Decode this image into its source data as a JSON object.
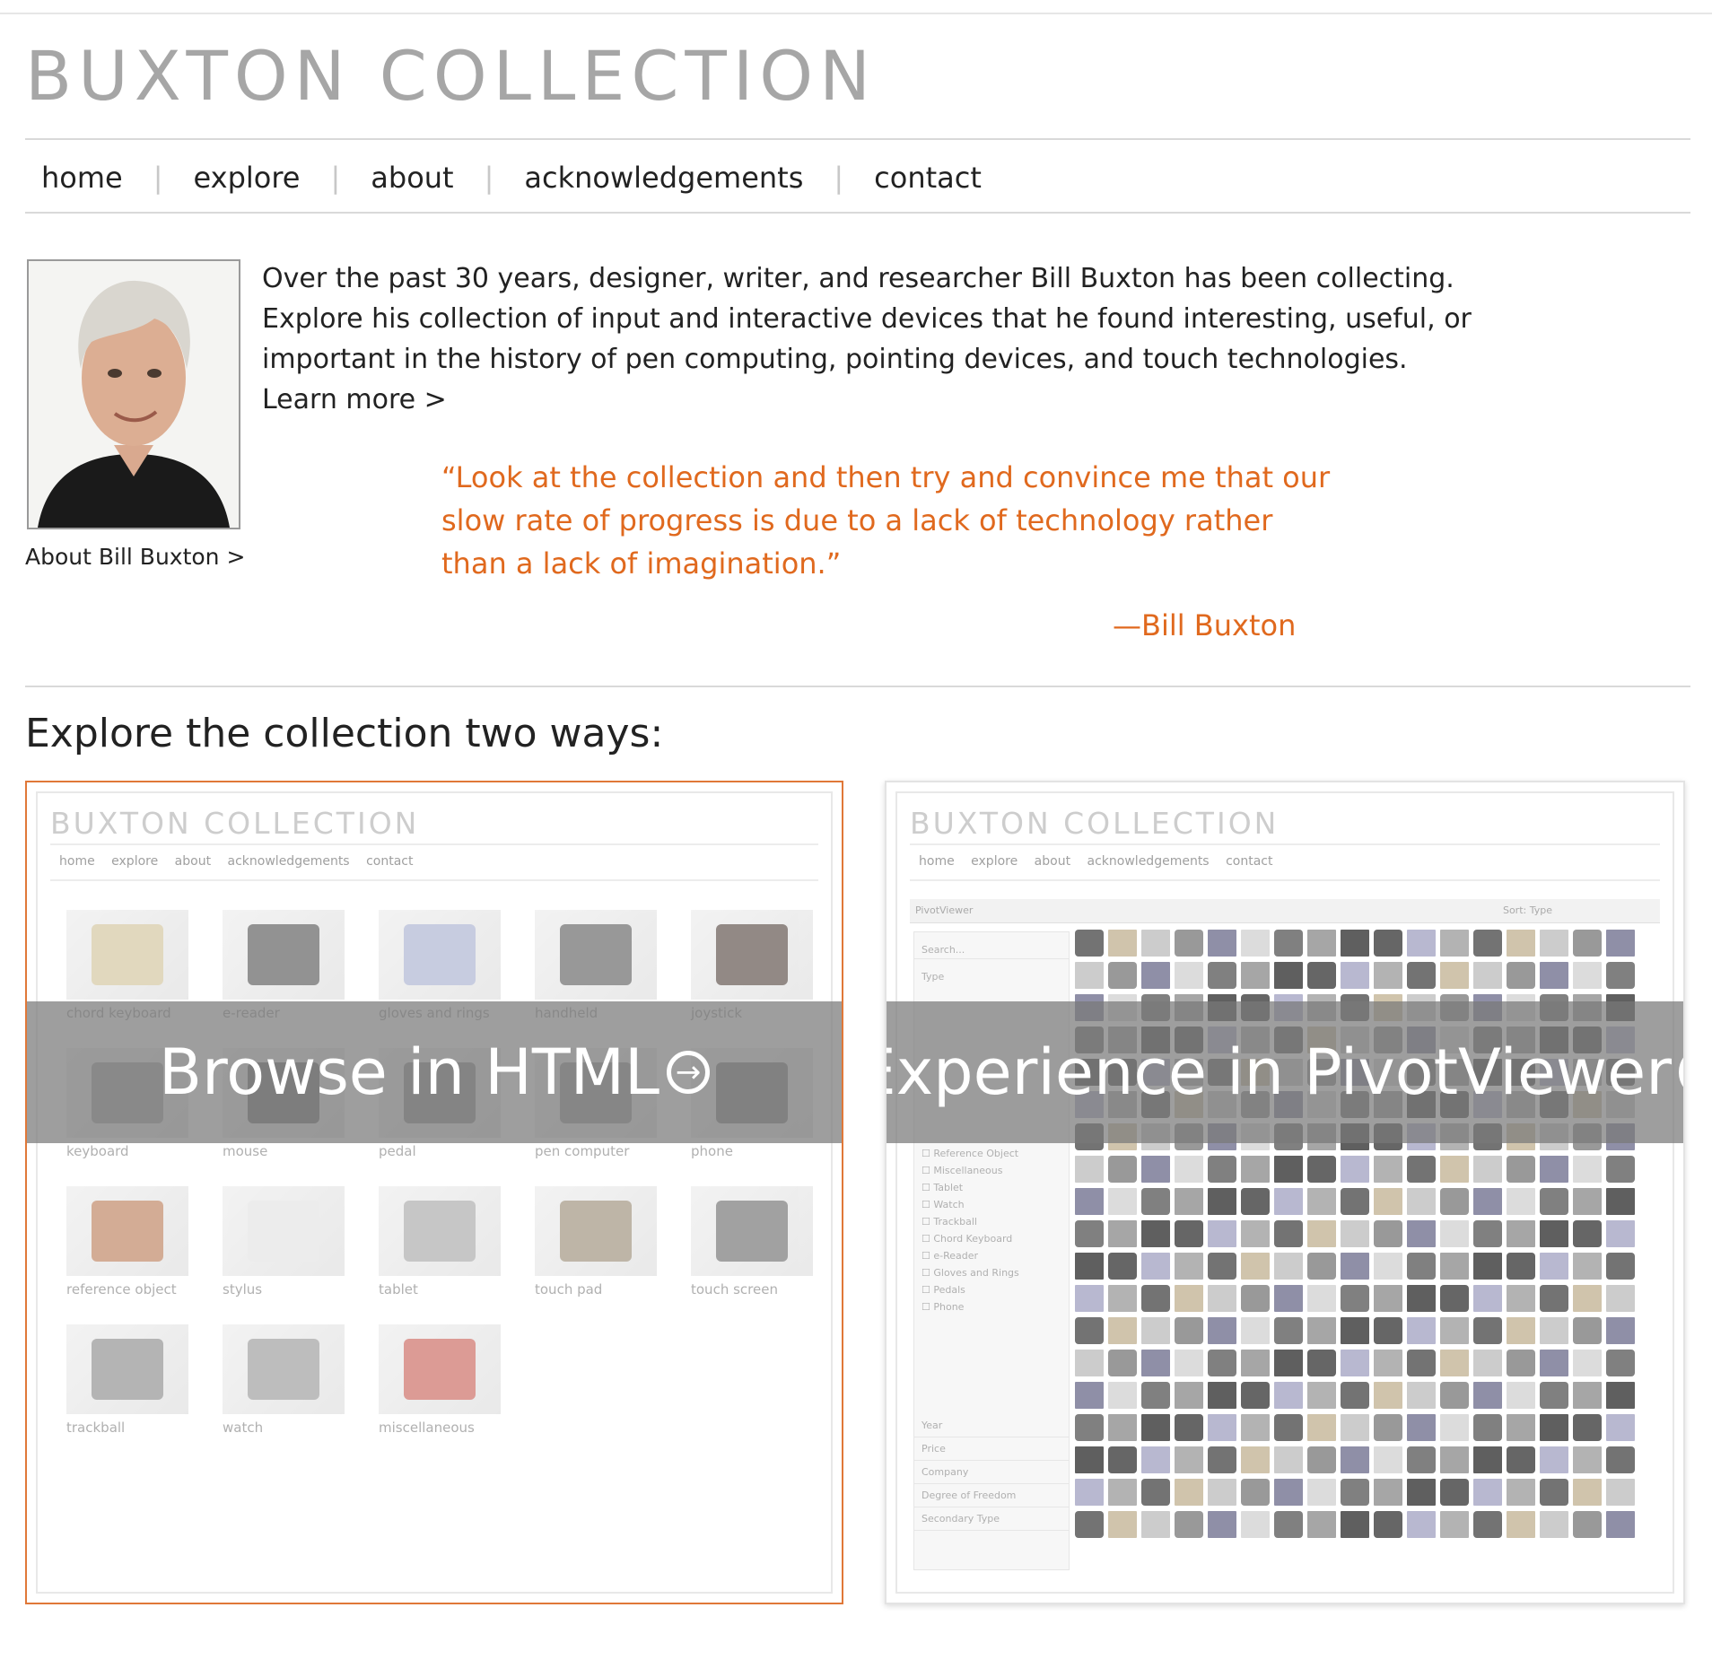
{
  "site": {
    "title": "BUXTON COLLECTION"
  },
  "nav": {
    "items": [
      "home",
      "explore",
      "about",
      "acknowledgements",
      "contact"
    ]
  },
  "about_link": "About Bill Buxton >",
  "intro": {
    "text": "Over the past 30 years, designer, writer, and researcher Bill Buxton has been collecting. Explore his collection of input and interactive devices that he found interesting, useful, or important in the history of pen computing, pointing devices, and touch technologies.",
    "learn_more": "Learn more >"
  },
  "quote": {
    "text": "“Look at the collection and then try and convince me that our slow rate of progress is due to a lack of technology rather than a lack of imagination.”",
    "attribution": "—Bill Buxton"
  },
  "explore": {
    "heading": "Explore the collection two ways:",
    "html_option": {
      "label": "Browse in HTML",
      "preview_title": "BUXTON COLLECTION",
      "preview_nav": [
        "home",
        "explore",
        "about",
        "acknowledgements",
        "contact"
      ],
      "categories": [
        "chord keyboard",
        "e-reader",
        "gloves and rings",
        "handheld",
        "joystick",
        "keyboard",
        "mouse",
        "pedal",
        "pen computer",
        "phone",
        "reference object",
        "stylus",
        "tablet",
        "touch pad",
        "touch screen",
        "trackball",
        "watch",
        "miscellaneous"
      ]
    },
    "pivot_option": {
      "label": "Experience in PivotViewer",
      "preview_title": "BUXTON COLLECTION",
      "preview_nav": [
        "home",
        "explore",
        "about",
        "acknowledgements",
        "contact"
      ],
      "toolbar_label": "PivotViewer",
      "sort_label": "Sort: Type",
      "search_placeholder": "Search...",
      "facet_header": "Type",
      "facets": [
        "Reference Object",
        "Miscellaneous",
        "Tablet",
        "Watch",
        "Trackball",
        "Chord Keyboard",
        "e-Reader",
        "Gloves and Rings",
        "Pedals",
        "Phone"
      ],
      "more_facets": [
        "Year",
        "Price",
        "Company",
        "Degree of Freedom",
        "Secondary Type"
      ]
    }
  },
  "colors": {
    "accent": "#e0691e",
    "title_gray": "#a6a6a6"
  }
}
